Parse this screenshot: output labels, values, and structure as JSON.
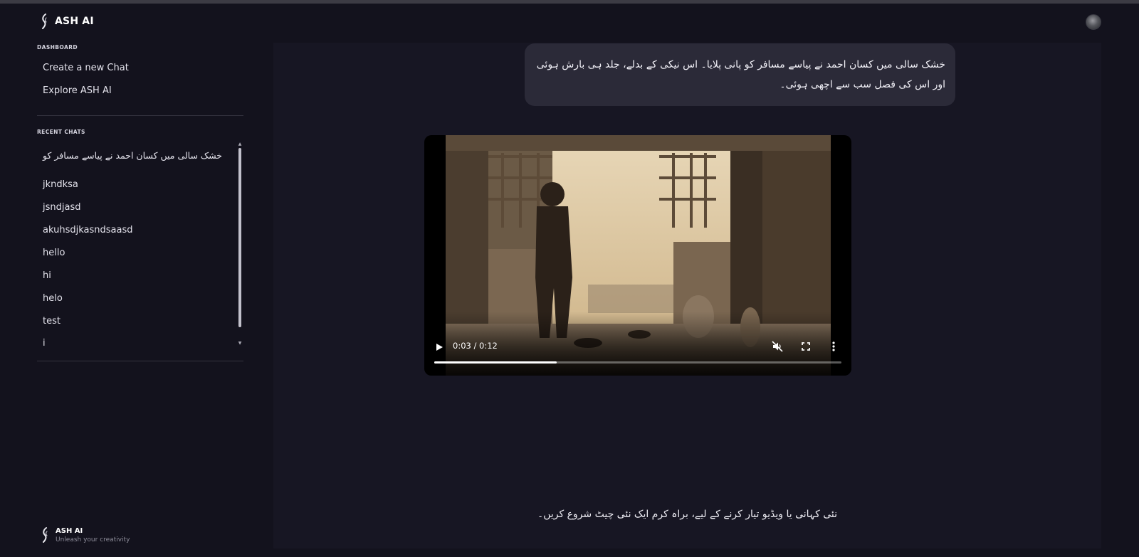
{
  "app": {
    "name": "ASH AI"
  },
  "sidebar": {
    "dashboard_label": "DASHBOARD",
    "nav": [
      {
        "label": "Create a new Chat"
      },
      {
        "label": "Explore ASH AI"
      }
    ],
    "recent_label": "RECENT CHATS",
    "recent_chats": [
      {
        "label": "خشک سالی میں کسان احمد نے پیاسے مسافر کو"
      },
      {
        "label": "jkndksa"
      },
      {
        "label": "jsndjasd"
      },
      {
        "label": "akuhsdjkasndsaasd"
      },
      {
        "label": "hello"
      },
      {
        "label": "hi"
      },
      {
        "label": "helo"
      },
      {
        "label": "test"
      },
      {
        "label": "i"
      }
    ],
    "footer": {
      "title": "ASH AI",
      "tagline": "Unleash your creativity"
    }
  },
  "chat": {
    "user_message": "خشک سالی میں کسان احمد نے پیاسے مسافر کو پانی پلایا۔ اس نیکی کے بدلے، جلد ہی بارش ہوئی اور اس کی فصل سب سے اچھی ہوئی۔",
    "video": {
      "time": "0:03 / 0:12",
      "progress": 0.3,
      "muted": true
    },
    "bottom_note": "نئی کہانی یا ویڈیو تیار کرنے کے لیے، براہ کرم ایک نئی چیٹ شروع کریں۔"
  },
  "colors": {
    "background": "#13121d",
    "panel": "#171623",
    "bubble": "#2b2a38"
  },
  "icons": [
    "logo-icon",
    "avatar",
    "play-icon",
    "mute-icon",
    "fullscreen-icon",
    "more-vertical-icon"
  ]
}
